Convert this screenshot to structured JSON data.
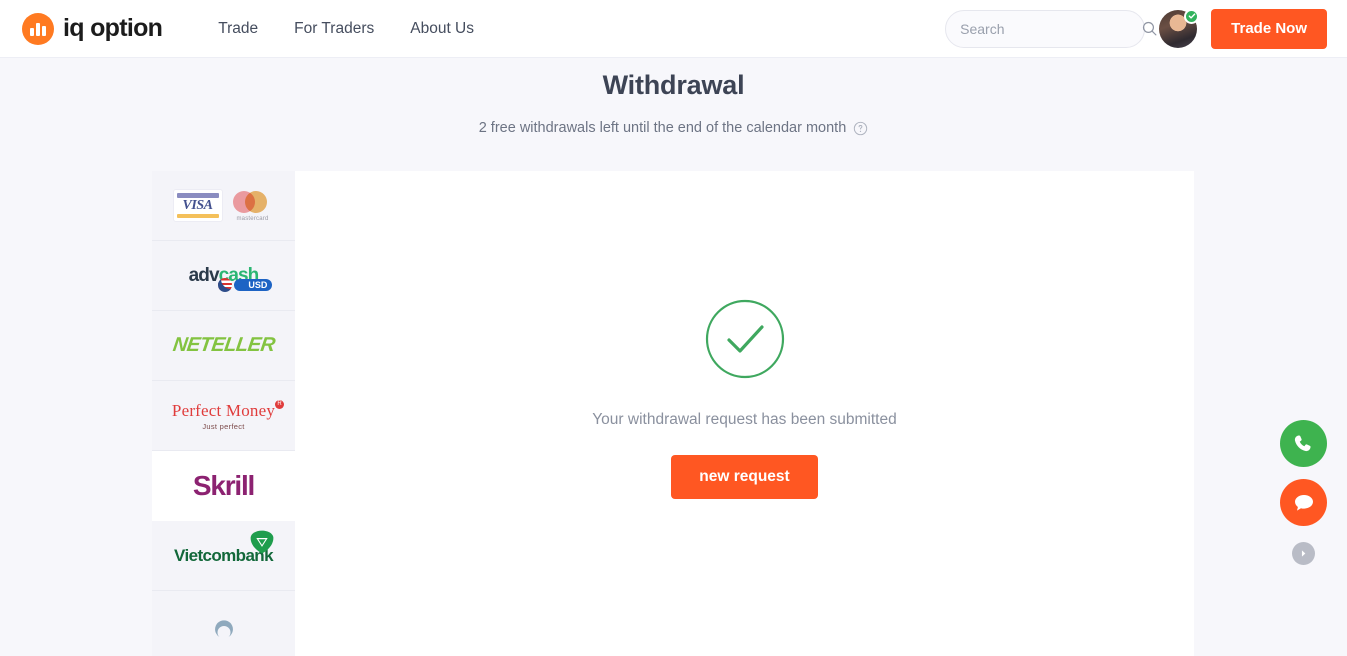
{
  "header": {
    "brand_text": "iq option",
    "brand_icon": "bars-logo-icon",
    "nav": [
      {
        "label": "Trade",
        "name": "nav-trade"
      },
      {
        "label": "For Traders",
        "name": "nav-for-traders"
      },
      {
        "label": "About Us",
        "name": "nav-about-us"
      }
    ],
    "search": {
      "placeholder": "Search",
      "value": "",
      "icon": "search-icon"
    },
    "avatar": {
      "name": "avatar",
      "badge_icon": "verified-check-icon"
    },
    "trade_now_label": "Trade Now"
  },
  "page": {
    "title": "Withdrawal",
    "subtitle": "2 free withdrawals left until the end of the calendar month",
    "subtitle_icon": "help-circle-icon"
  },
  "methods": [
    {
      "id": "visa-mastercard",
      "label": "VISA / mastercard",
      "visa_text": "VISA",
      "mc_text": "mastercard",
      "selected": false
    },
    {
      "id": "advcash",
      "label": "advcash USD",
      "text_a": "adv",
      "text_b": "cash",
      "badge": "USD",
      "selected": false
    },
    {
      "id": "neteller",
      "label": "NETELLER",
      "text": "NETELLER",
      "selected": false
    },
    {
      "id": "perfect-money",
      "label": "Perfect Money",
      "text": "Perfect Money",
      "tagline": "Just perfect",
      "reg": "R",
      "selected": false
    },
    {
      "id": "skrill",
      "label": "Skrill",
      "text": "Skrill",
      "selected": true
    },
    {
      "id": "vietcombank",
      "label": "Vietcombank",
      "text": "Vietcombank",
      "selected": false
    },
    {
      "id": "partial-method",
      "label": "",
      "text": "",
      "selected": false
    }
  ],
  "success": {
    "icon": "check-circle-icon",
    "message": "Your withdrawal request has been submitted",
    "button_label": "new request"
  },
  "floating": {
    "call_icon": "phone-icon",
    "chat_icon": "chat-bubble-icon",
    "toggle_icon": "chevron-right-icon"
  },
  "colors": {
    "accent_orange": "#ff5722",
    "brand_orange": "#ff7a21",
    "success_green": "#3eb34f",
    "page_bg": "#f7f7fb",
    "panel_bg": "#ffffff",
    "sidebar_bg": "#f4f4f9"
  }
}
